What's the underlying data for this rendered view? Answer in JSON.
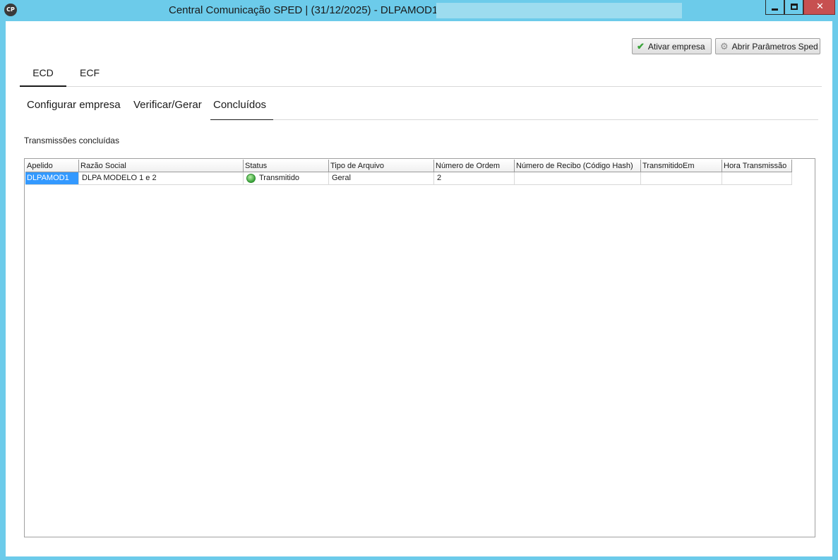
{
  "window": {
    "icon_text": "CP",
    "title": "Central Comunicação SPED | (31/12/2025) - DLPAMOD1 -",
    "close_glyph": "✕"
  },
  "toolbar": {
    "ativar_label": "Ativar empresa",
    "abrir_label": "Abrir Parâmetros Sped"
  },
  "main_tabs": [
    "ECD",
    "ECF"
  ],
  "sub_tabs": [
    "Configurar empresa",
    "Verificar/Gerar",
    "Concluídos"
  ],
  "section_label": "Transmissões concluídas",
  "grid": {
    "columns": [
      "Apelido",
      "Razão Social",
      "Status",
      "Tipo de Arquivo",
      "Número de Ordem",
      "Número de Recibo (Código Hash)",
      "TransmitidoEm",
      "Hora Transmissão"
    ],
    "rows": [
      {
        "apelido": "DLPAMOD1",
        "razao_social": "DLPA MODELO 1 e 2",
        "status": "Transmitido",
        "tipo_arquivo": "Geral",
        "numero_ordem": "2",
        "numero_recibo": "",
        "transmitido_em": "",
        "hora_transmissao": ""
      }
    ]
  },
  "colors": {
    "frame": "#6ccbea",
    "selection": "#3399ff",
    "status_ok": "#3aa33a",
    "close_button": "#c75050"
  }
}
